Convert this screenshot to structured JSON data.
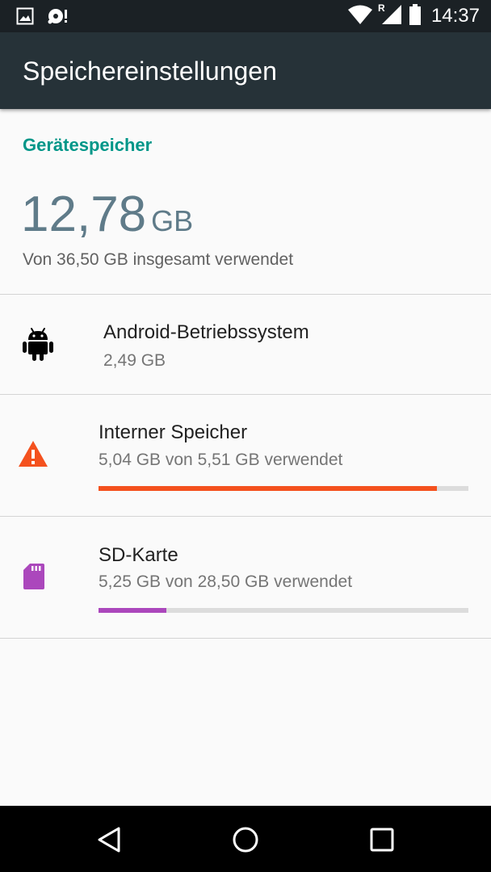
{
  "status_bar": {
    "time": "14:37",
    "icons": [
      "image-icon",
      "sync-alert-icon",
      "wifi-icon",
      "signal-roaming-icon",
      "battery-icon"
    ],
    "roaming_label": "R"
  },
  "app_bar": {
    "title": "Speichereinstellungen"
  },
  "device_storage": {
    "header": "Gerätespeicher",
    "used_value": "12,78",
    "used_unit": "GB",
    "summary": "Von 36,50 GB insgesamt verwendet"
  },
  "items": [
    {
      "title": "Android-Betriebssystem",
      "subtitle": "2,49 GB",
      "icon": "android-icon"
    },
    {
      "title": "Interner Speicher",
      "subtitle": "5,04 GB von 5,51 GB verwendet",
      "icon": "warning-icon",
      "usage_fraction": 0.915,
      "color": "#f4511e"
    },
    {
      "title": "SD-Karte",
      "subtitle": "5,25 GB von 28,50 GB verwendet",
      "icon": "sd-card-icon",
      "usage_fraction": 0.184,
      "color": "#ab47bc"
    }
  ],
  "colors": {
    "accent": "#009688",
    "app_bar": "#263238",
    "status_bar": "#1b2125",
    "warning": "#f4511e",
    "sd_card": "#ab47bc"
  },
  "nav_bar": {
    "icons": [
      "back-icon",
      "home-icon",
      "recents-icon"
    ]
  }
}
